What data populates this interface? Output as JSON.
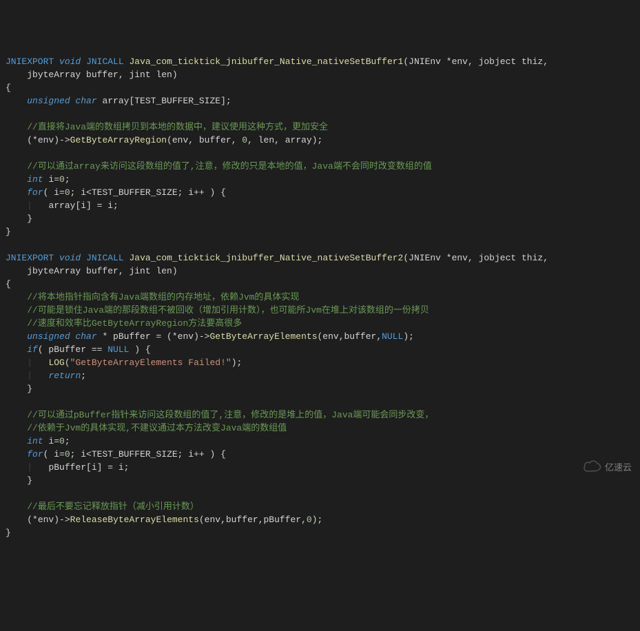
{
  "code": {
    "fn1": {
      "export": "JNIEXPORT",
      "ret": "void",
      "call": "JNICALL",
      "name": "Java_com_ticktick_jnibuffer_Native_nativeSetBuffer1",
      "params_line1": "(JNIEnv *env, jobject thiz,",
      "params_line2": "jbyteArray buffer, jint len)",
      "brace_open": "{",
      "decl_kw": "unsigned char",
      "decl_rest": " array[TEST_BUFFER_SIZE];",
      "cmt1": "//直接将Java端的数组拷贝到本地的数据中，建议使用这种方式，更加安全",
      "call1_pre": "(*env)->",
      "call1_fn": "GetByteArrayRegion",
      "call1_args_a": "(env, buffer, ",
      "call1_args_b": ", len, array);",
      "zero": "0",
      "cmt2": "//可以通过array来访问这段数组的值了,注意，修改的只是本地的值，Java端不会同时改变数组的值",
      "int_kw": "int",
      "int_decl": " i=",
      "semicolon": ";",
      "for_kw": "for",
      "for_a": "( i=",
      "for_b": "; i<TEST_BUFFER_SIZE; i++ ) {",
      "body": "array[i] = i;",
      "brace_close_inner": "}",
      "brace_close": "}"
    },
    "fn2": {
      "export": "JNIEXPORT",
      "ret": "void",
      "call": "JNICALL",
      "name": "Java_com_ticktick_jnibuffer_Native_nativeSetBuffer2",
      "params_line1": "(JNIEnv *env, jobject thiz,",
      "params_line2": "jbyteArray buffer, jint len)",
      "brace_open": "{",
      "cmt1": "//将本地指针指向含有Java端数组的内存地址，依赖Jvm的具体实现",
      "cmt2": "//可能是锁住Java端的那段数组不被回收（增加引用计数），也可能所Jvm在堆上对该数组的一份拷贝",
      "cmt3": "//速度和效率比GetByteArrayRegion方法要高很多",
      "decl_kw": "unsigned char",
      "decl_rest_a": " * pBuffer = (*env)->",
      "decl_fn": "GetByteArrayElements",
      "decl_rest_b": "(env,buffer,",
      "decl_rest_c": ");",
      "null": "NULL",
      "if_kw": "if",
      "if_cond_a": "( pBuffer == ",
      "if_cond_b": " ) {",
      "log_fn": "LOG",
      "log_a": "(",
      "log_str": "\"GetByteArrayElements Failed!\"",
      "log_b": ");",
      "return_kw": "return",
      "semicolon": ";",
      "brace_close_inner": "}",
      "cmt4": "//可以通过pBuffer指针来访问这段数组的值了,注意，修改的是堆上的值，Java端可能会同步改变，",
      "cmt5": "//依赖于Jvm的具体实现,不建议通过本方法改变Java端的数组值",
      "int_kw": "int",
      "int_decl": " i=",
      "zero": "0",
      "for_kw": "for",
      "for_a": "( i=",
      "for_b": "; i<TEST_BUFFER_SIZE; i++ ) {",
      "body": "pBuffer[i] = i;",
      "cmt6": "//最后不要忘记释放指针（减小引用计数）",
      "rel_pre": "(*env)->",
      "rel_fn": "ReleaseByteArrayElements",
      "rel_args_a": "(env,buffer,pBuffer,",
      "rel_args_b": ");",
      "brace_close": "}"
    }
  },
  "watermark": "亿速云"
}
